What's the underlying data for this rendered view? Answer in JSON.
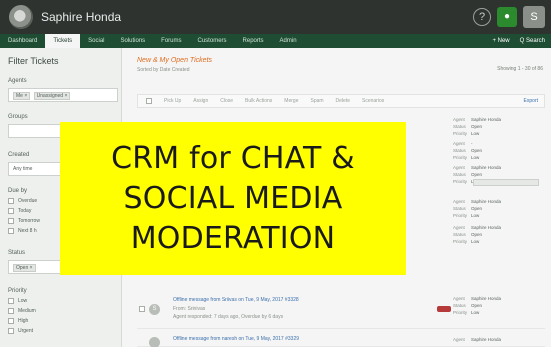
{
  "header": {
    "brand": "Saphire Honda",
    "help_icon": "?",
    "user_initial": "S"
  },
  "nav": {
    "tabs": [
      {
        "label": "Dashboard",
        "active": false
      },
      {
        "label": "Tickets",
        "active": true
      },
      {
        "label": "Social",
        "active": false
      },
      {
        "label": "Solutions",
        "active": false
      },
      {
        "label": "Forums",
        "active": false
      },
      {
        "label": "Customers",
        "active": false
      },
      {
        "label": "Reports",
        "active": false
      },
      {
        "label": "Admin",
        "active": false
      }
    ],
    "new_label": "+ New",
    "search_label": "Q Search"
  },
  "sidebar": {
    "title": "Filter Tickets",
    "agents_label": "Agents",
    "agents_chips": [
      "Me ×",
      "Unassigned ×"
    ],
    "groups_label": "Groups",
    "created_label": "Created",
    "created_value": "Any time",
    "dueby_label": "Due by",
    "dueby_options": [
      "Overdue",
      "Today",
      "Tomorrow",
      "Next 8 h"
    ],
    "status_label": "Status",
    "status_chip": "Open ×",
    "priority_label": "Priority",
    "priority_options": [
      "Low",
      "Medium",
      "High",
      "Urgent"
    ]
  },
  "main": {
    "view_title": "New & My Open Tickets",
    "sorted_by": "Sorted by Date Created",
    "pager": "Showing 1 - 30 of 86",
    "toolbar_actions": [
      "Pick Up",
      "Assign",
      "Close",
      "Bulk Actions",
      "Merge",
      "Spam",
      "Delete",
      "Scenarios"
    ],
    "export_label": "Export"
  },
  "tickets": [
    {
      "title": "Offline message from Sriivas on Tue, 9 May, 2017 #3328",
      "from": "From: Srinivas",
      "meta": "Agent responded: 7 days ago, Overdue by 6 days",
      "avatar": "S",
      "agent": "Saphire Honda",
      "status": "Open",
      "priority": "Low"
    },
    {
      "title": "Offline message from naresh on Tue, 9 May, 2017 #3329",
      "agent": "Saphire Honda"
    }
  ],
  "side_props": [
    {
      "agent": "Saphire Honda",
      "status": "Open",
      "priority": "Low"
    },
    {
      "agent": "-",
      "status": "Open",
      "priority": "Low"
    },
    {
      "agent": "Saphire Honda",
      "status": "Open",
      "priority": "Low"
    },
    {
      "agent": "Saphire Honda",
      "status": "Open",
      "priority": "Low"
    },
    {
      "agent": "Saphire Honda",
      "status": "Open",
      "priority": "Low"
    }
  ],
  "prop_labels": {
    "agent": "Agent",
    "status": "Status",
    "priority": "Priority"
  },
  "banner": {
    "line1": "CRM for CHAT &",
    "line2": "SOCIAL MEDIA",
    "line3": "MODERATION"
  }
}
